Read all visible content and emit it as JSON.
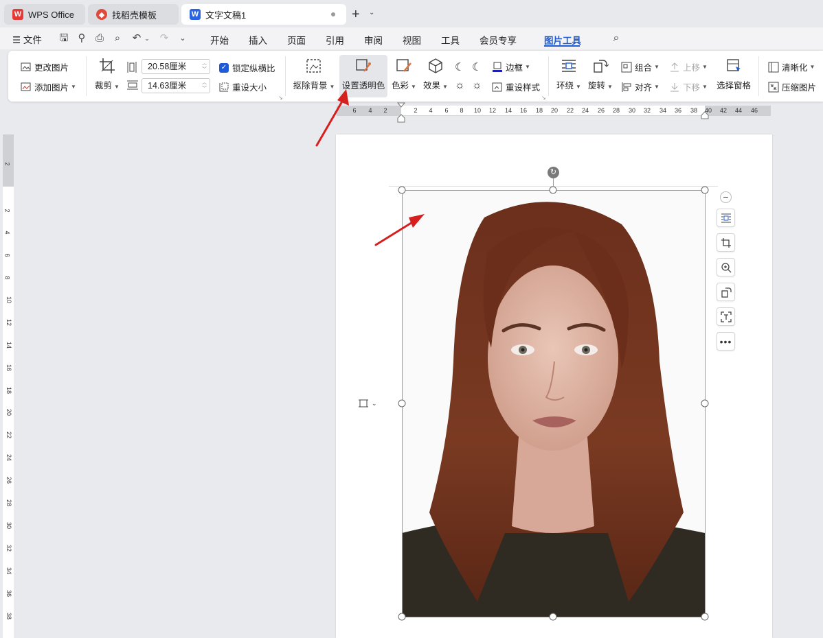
{
  "tabs": [
    {
      "label": "WPS Office",
      "icon": "wps-logo-icon"
    },
    {
      "label": "找稻壳模板",
      "icon": "docer-logo-icon"
    },
    {
      "label": "文字文稿1",
      "icon": "writer-logo-icon",
      "active": true
    }
  ],
  "menu": {
    "file": "文件",
    "items": [
      "开始",
      "插入",
      "页面",
      "引用",
      "审阅",
      "视图",
      "工具",
      "会员专享",
      "图片工具"
    ],
    "active": "图片工具"
  },
  "ribbon": {
    "change_picture": "更改图片",
    "add_picture": "添加图片",
    "crop": "裁剪",
    "width_value": "20.58厘米",
    "height_value": "14.63厘米",
    "lock_ratio": "锁定纵横比",
    "reset_size": "重设大小",
    "remove_bg": "抠除背景",
    "set_transparent": "设置透明色",
    "color": "色彩",
    "effects": "效果",
    "border": "边框",
    "reset_style": "重设样式",
    "wrap": "环绕",
    "rotate": "旋转",
    "group": "组合",
    "align": "对齐",
    "bring_forward": "上移",
    "send_backward": "下移",
    "selection_pane": "选择窗格",
    "sharpen": "清晰化",
    "compress": "压缩图片"
  },
  "ruler_h": [
    "6",
    "4",
    "2",
    "2",
    "4",
    "6",
    "8",
    "10",
    "12",
    "14",
    "16",
    "18",
    "20",
    "22",
    "24",
    "26",
    "28",
    "30",
    "32",
    "34",
    "36",
    "38",
    "40",
    "42",
    "44",
    "46"
  ],
  "ruler_v": [
    "2",
    "2",
    "4",
    "6",
    "8",
    "10",
    "12",
    "14",
    "16",
    "18",
    "20",
    "22",
    "24",
    "26",
    "28",
    "30",
    "32",
    "34",
    "36",
    "38"
  ],
  "colors": {
    "accent": "#1f5bd6",
    "arrow": "#d61f1f",
    "wps_red": "#e53935"
  }
}
